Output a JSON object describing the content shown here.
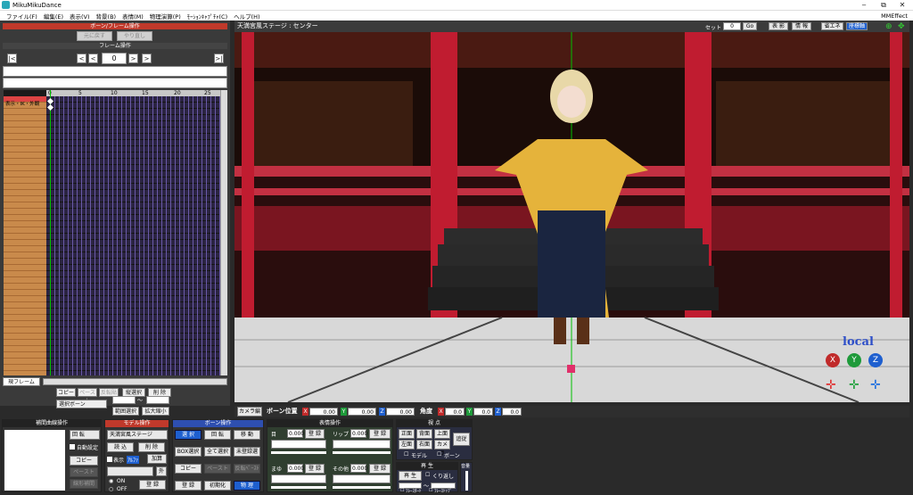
{
  "window": {
    "title": "MikuMikuDance",
    "minimize": "‒",
    "maximize": "⧉",
    "close": "✕"
  },
  "menu": [
    "ファイル(F)",
    "編集(E)",
    "表示(V)",
    "背景(B)",
    "表情(M)",
    "物理演算(P)",
    "ﾓｰｼｮﾝｷｬﾌﾟﾁｬ(C)",
    "ヘルプ(H)"
  ],
  "menu_right": "MMEffect",
  "left": {
    "header": "ボーン/フレーム操作",
    "undo": "元に戻す",
    "redo": "やり直し",
    "frame_head": "フレーム操作",
    "frame_value": "0",
    "nav": {
      "first": "|<",
      "prev": "<",
      "prev_key": "<",
      "next_key": ">",
      "next": ">",
      "last": ">|"
    },
    "ruler": [
      "0",
      "5",
      "10",
      "15",
      "20",
      "25"
    ],
    "row_label": "表示・IK・外観",
    "current_frame": "現フレーム",
    "copy": "コピー",
    "paste": "ペースト",
    "reverse": "反転貼",
    "vertical_select": "縦選択",
    "delete": "削 除",
    "select_bone": "選択ボーン",
    "tilde": "～",
    "range_select": "範囲選択",
    "expand": "拡大縮小"
  },
  "viewport": {
    "title": "天満宮風ステージ : センター",
    "set_label": "セット",
    "set_value": "0",
    "go": "Go",
    "buttons": [
      "表 影",
      "情 報",
      "省エネ",
      "座標軸"
    ],
    "local_label": "local"
  },
  "bone_bar": {
    "camera": "カメラ編",
    "title": "ボーン位置",
    "x": "0.00",
    "y": "0.00",
    "z": "0.00",
    "angle": "角度",
    "ax": "0.0",
    "ay": "0.0",
    "az": "0.0"
  },
  "interp": {
    "header": "補間曲線操作",
    "rotate": "回 転",
    "auto": "自動設定",
    "copy": "コピー",
    "paste": "ペースト",
    "linear": "線形補間"
  },
  "model": {
    "header": "モデル操作",
    "name": "天満宮風ステージ",
    "load": "読 込",
    "delete": "削 除",
    "show": "表示",
    "add": "加算",
    "outside": "外",
    "on": "ON",
    "off": "OFF",
    "register": "登 録",
    "badge": "ｱﾙﾌｧ"
  },
  "bone_ops": {
    "header": "ボーン操作",
    "select": "選 択",
    "rotate": "回 転",
    "move": "移 動",
    "box": "BOX選択",
    "all": "全て選択",
    "unreg": "未登録選",
    "copy": "コピー",
    "paste": "ペースト",
    "reverse": "反転ﾍﾟｰｽﾄ",
    "register": "登 録",
    "init": "初期化",
    "physics": "物 理"
  },
  "face": {
    "header": "表情操作",
    "eye": "目",
    "lip": "リップ",
    "brow": "まゆ",
    "other": "その他",
    "val": "0.000",
    "register": "登 録"
  },
  "view": {
    "header": "視 点",
    "front": "正面",
    "back": "背面",
    "top": "上面",
    "left": "左面",
    "right": "右面",
    "camera": "カメラ",
    "track": "追従",
    "model": "モデル",
    "bone": "ボーン"
  },
  "play": {
    "header": "再 生",
    "play": "再 生",
    "repeat": "くり返し",
    "frame_start": "ﾌﾚｰｽﾀｰﾄ",
    "frame_stop": "ﾌﾚｰｽﾄｯﾌﾟ",
    "volume": "音量",
    "tilde": "～"
  },
  "colors": {
    "accent_red": "#c0392b",
    "accent_blue": "#1e5fcf"
  }
}
